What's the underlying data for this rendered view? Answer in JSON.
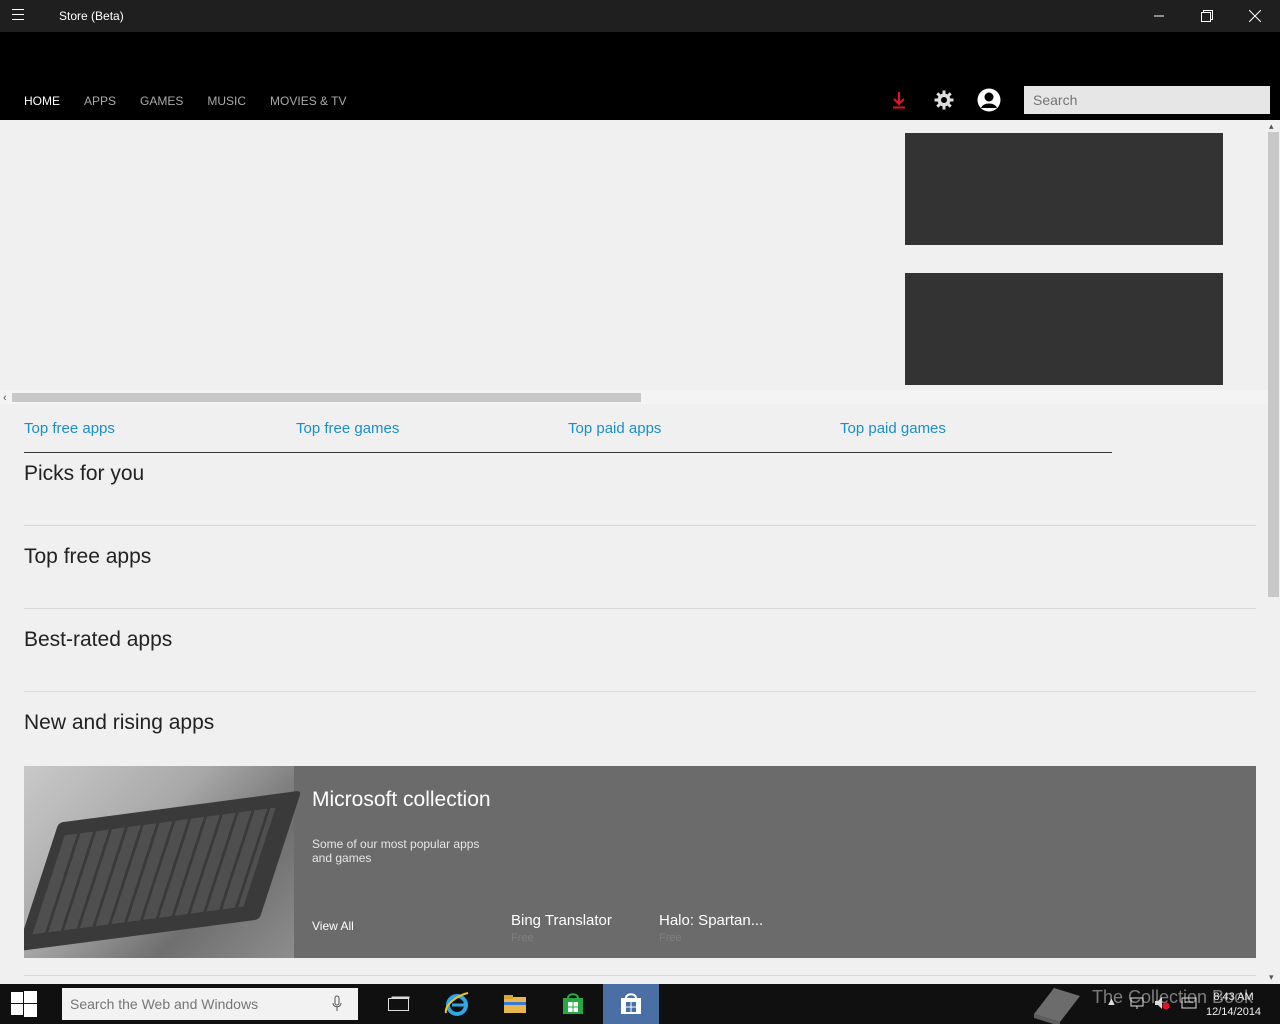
{
  "window": {
    "title": "Store (Beta)"
  },
  "nav": {
    "items": [
      "HOME",
      "APPS",
      "GAMES",
      "MUSIC",
      "MOVIES & TV"
    ],
    "active": "HOME"
  },
  "search": {
    "placeholder": "Search"
  },
  "quick_links": [
    "Top free apps",
    "Top free games",
    "Top paid apps",
    "Top paid games"
  ],
  "sections": [
    "Picks for you",
    "Top free apps",
    "Best-rated apps",
    "New and rising apps"
  ],
  "banner": {
    "title": "Microsoft collection",
    "subtitle": "Some of our most popular apps and games",
    "view_all": "View All",
    "apps": [
      {
        "name": "Bing Translator",
        "price": "Free"
      },
      {
        "name": "Halo: Spartan...",
        "price": "Free"
      }
    ]
  },
  "taskbar": {
    "search_placeholder": "Search the Web and Windows",
    "time": "8:43 AM",
    "date": "12/14/2014",
    "watermark": "The Collection Book"
  },
  "colors": {
    "accent": "#1a8fc9",
    "download": "#e81123",
    "tile": "#333333",
    "banner": "#6b6b6b"
  }
}
